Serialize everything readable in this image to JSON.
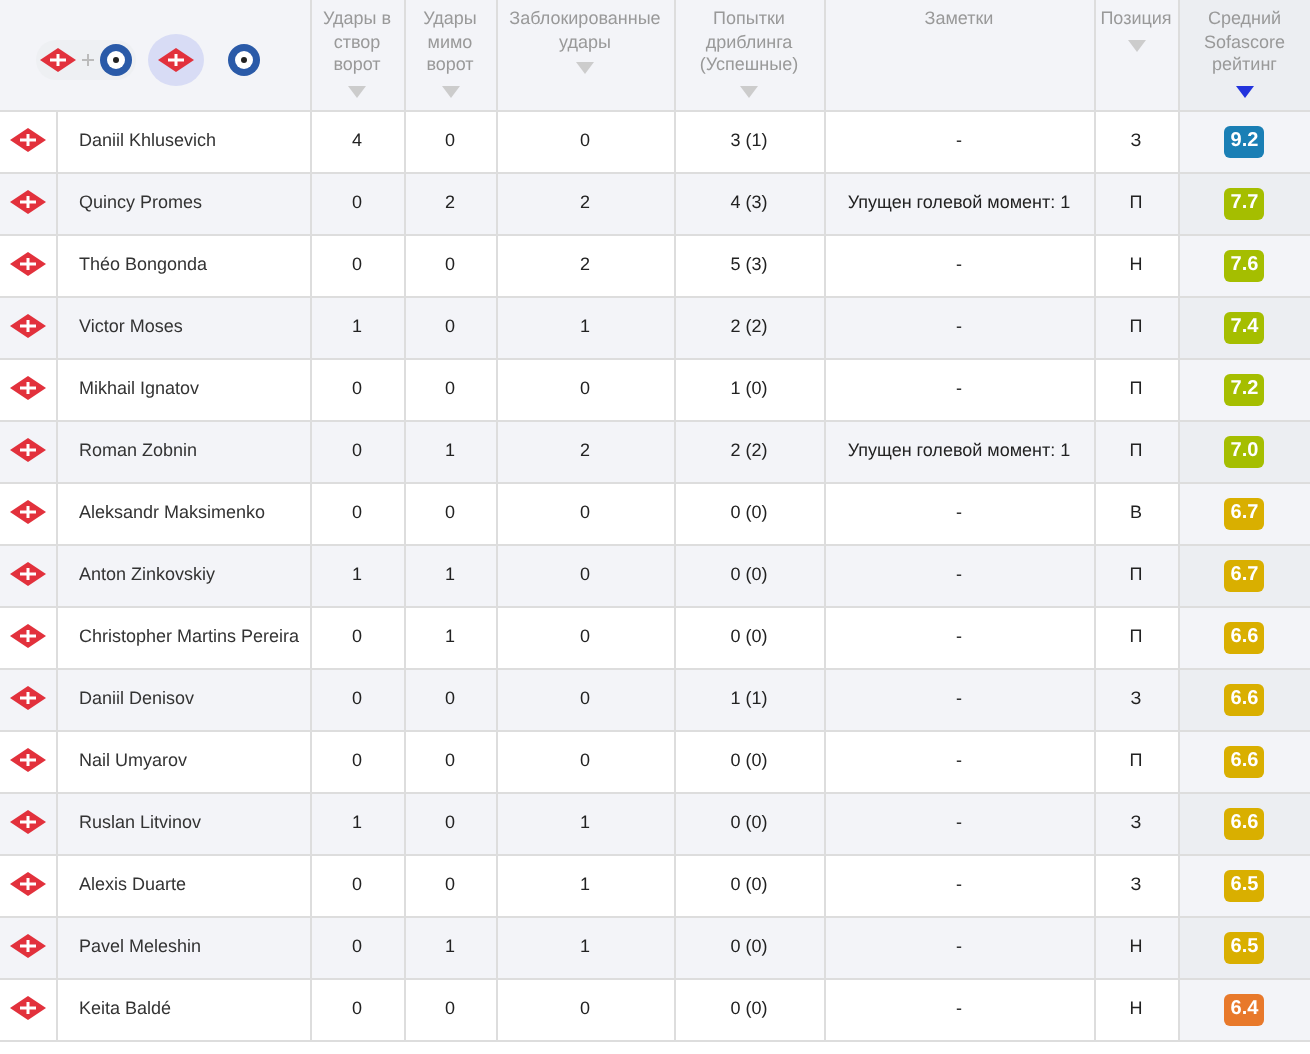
{
  "team_filter": [
    {
      "kind": "both",
      "selected": false
    },
    {
      "kind": "home",
      "selected": true
    },
    {
      "kind": "away",
      "selected": false
    }
  ],
  "columns": [
    {
      "label": "Удары в створ ворот",
      "kind": "sortable",
      "sorted": false
    },
    {
      "label": "Удары мимо ворот",
      "kind": "sortable",
      "sorted": false
    },
    {
      "label": "Заблокированные удары",
      "kind": "sortable",
      "sorted": false
    },
    {
      "label": "Попытки дриблинга (Успешные)",
      "kind": "sortable",
      "sorted": false
    },
    {
      "label": "Заметки",
      "kind": "plain"
    },
    {
      "label": "Позиция",
      "kind": "sortable",
      "sorted": false
    },
    {
      "label": "Средний Sofascore рейтинг",
      "kind": "sortable",
      "sorted": true
    }
  ],
  "rows": [
    {
      "player": "Daniil Khlusevich",
      "on_target": "4",
      "off_target": "0",
      "blocked": "0",
      "dribbles": "3 (1)",
      "notes": "-",
      "position": "З",
      "rating": "9.2",
      "color": "#1a7fb5"
    },
    {
      "player": "Quincy Promes",
      "on_target": "0",
      "off_target": "2",
      "blocked": "2",
      "dribbles": "4 (3)",
      "notes": "Упущен голевой момент: 1",
      "position": "П",
      "rating": "7.7",
      "color": "#a5be00"
    },
    {
      "player": "Théo Bongonda",
      "on_target": "0",
      "off_target": "0",
      "blocked": "2",
      "dribbles": "5 (3)",
      "notes": "-",
      "position": "Н",
      "rating": "7.6",
      "color": "#a5be00"
    },
    {
      "player": "Victor Moses",
      "on_target": "1",
      "off_target": "0",
      "blocked": "1",
      "dribbles": "2 (2)",
      "notes": "-",
      "position": "П",
      "rating": "7.4",
      "color": "#a5be00"
    },
    {
      "player": "Mikhail Ignatov",
      "on_target": "0",
      "off_target": "0",
      "blocked": "0",
      "dribbles": "1 (0)",
      "notes": "-",
      "position": "П",
      "rating": "7.2",
      "color": "#a5be00"
    },
    {
      "player": "Roman Zobnin",
      "on_target": "0",
      "off_target": "1",
      "blocked": "2",
      "dribbles": "2 (2)",
      "notes": "Упущен голевой момент: 1",
      "position": "П",
      "rating": "7.0",
      "color": "#a5be00"
    },
    {
      "player": "Aleksandr Maksimenko",
      "on_target": "0",
      "off_target": "0",
      "blocked": "0",
      "dribbles": "0 (0)",
      "notes": "-",
      "position": "В",
      "rating": "6.7",
      "color": "#d9af00"
    },
    {
      "player": "Anton Zinkovskiy",
      "on_target": "1",
      "off_target": "1",
      "blocked": "0",
      "dribbles": "0 (0)",
      "notes": "-",
      "position": "П",
      "rating": "6.7",
      "color": "#d9af00"
    },
    {
      "player": "Christopher Martins Pereira",
      "on_target": "0",
      "off_target": "1",
      "blocked": "0",
      "dribbles": "0 (0)",
      "notes": "-",
      "position": "П",
      "rating": "6.6",
      "color": "#d9af00"
    },
    {
      "player": "Daniil Denisov",
      "on_target": "0",
      "off_target": "0",
      "blocked": "0",
      "dribbles": "1 (1)",
      "notes": "-",
      "position": "З",
      "rating": "6.6",
      "color": "#d9af00"
    },
    {
      "player": "Nail Umyarov",
      "on_target": "0",
      "off_target": "0",
      "blocked": "0",
      "dribbles": "0 (0)",
      "notes": "-",
      "position": "П",
      "rating": "6.6",
      "color": "#d9af00"
    },
    {
      "player": "Ruslan Litvinov",
      "on_target": "1",
      "off_target": "0",
      "blocked": "1",
      "dribbles": "0 (0)",
      "notes": "-",
      "position": "З",
      "rating": "6.6",
      "color": "#d9af00"
    },
    {
      "player": "Alexis Duarte",
      "on_target": "0",
      "off_target": "0",
      "blocked": "1",
      "dribbles": "0 (0)",
      "notes": "-",
      "position": "З",
      "rating": "6.5",
      "color": "#d9af00"
    },
    {
      "player": "Pavel Meleshin",
      "on_target": "0",
      "off_target": "1",
      "blocked": "1",
      "dribbles": "0 (0)",
      "notes": "-",
      "position": "Н",
      "rating": "6.5",
      "color": "#d9af00"
    },
    {
      "player": "Keita Baldé",
      "on_target": "0",
      "off_target": "0",
      "blocked": "0",
      "dribbles": "0 (0)",
      "notes": "-",
      "position": "Н",
      "rating": "6.4",
      "color": "#e8792b"
    }
  ]
}
